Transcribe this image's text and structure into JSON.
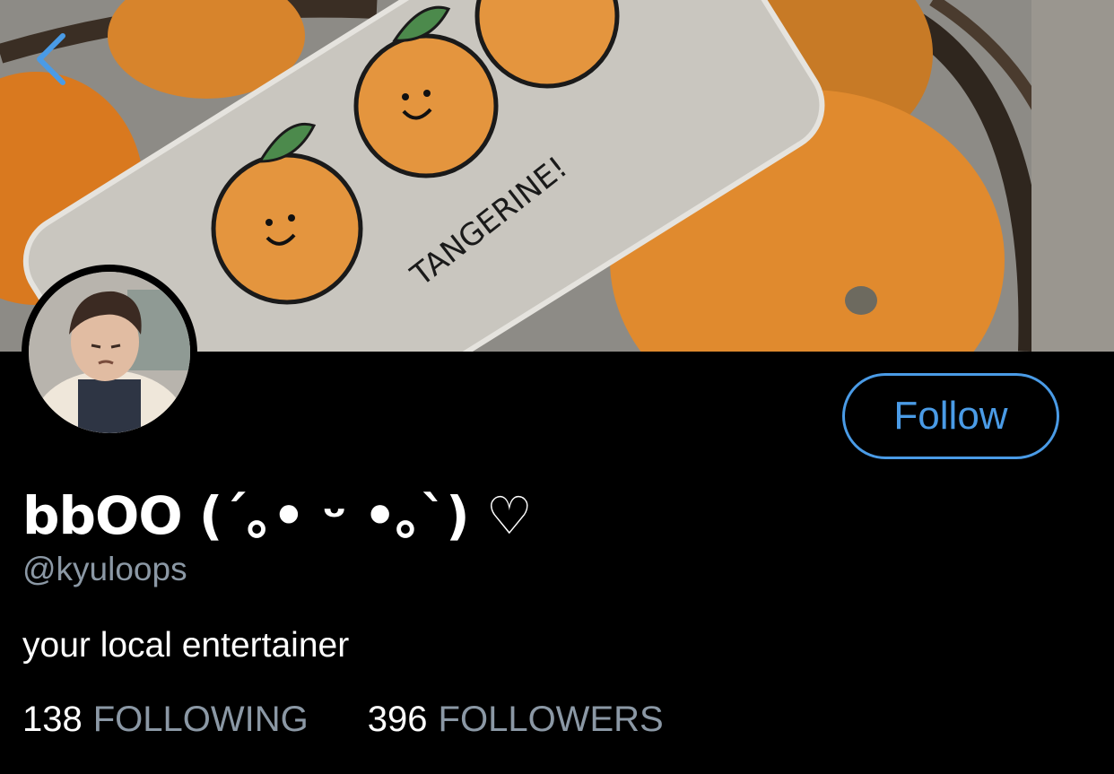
{
  "header": {
    "phone_case_text": "TANGERINE!"
  },
  "profile": {
    "display_name": "bbOO (´｡• ᵕ •｡`) ♡",
    "handle": "@kyuloops",
    "bio": "your local entertainer",
    "follow_label": "Follow",
    "following_count": "138",
    "following_label": "FOLLOWING",
    "followers_count": "396",
    "followers_label": "FOLLOWERS"
  },
  "icons": {
    "back": "chevron-left-icon"
  },
  "colors": {
    "accent": "#4a9be6",
    "muted_text": "#8b98a5",
    "background": "#000000"
  }
}
